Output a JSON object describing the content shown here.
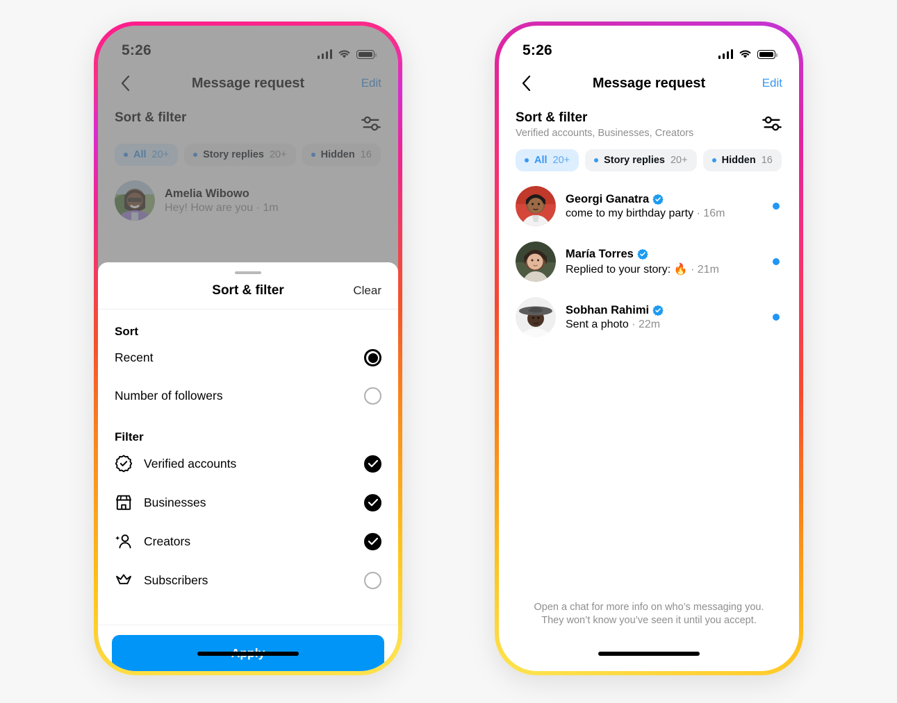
{
  "status_bar": {
    "time": "5:26",
    "signal_icon": "cellular-signal-icon",
    "wifi_icon": "wifi-icon",
    "battery_icon": "battery-full-icon"
  },
  "nav": {
    "back_icon": "chevron-left-icon",
    "title": "Message request",
    "edit_label": "Edit"
  },
  "colors": {
    "accent_blue": "#3797f0",
    "apply_blue": "#0095f6",
    "unread_blue": "#2196f3",
    "muted_gray": "#8e8e8e",
    "chip_bg": "#f1f2f4",
    "chip_active_bg": "#ddeeff"
  },
  "left_phone": {
    "sort_filter": {
      "title": "Sort & filter",
      "subtitle": "",
      "slider_icon": "sliders-icon"
    },
    "chips": [
      {
        "label": "All",
        "count": "20+",
        "active": true
      },
      {
        "label": "Story replies",
        "count": "20+",
        "active": false
      },
      {
        "label": "Hidden",
        "count": "16",
        "active": false
      }
    ],
    "messages": [
      {
        "name": "Amelia Wibowo",
        "preview": "Hey! How are you",
        "time": "· 1m",
        "verified": false,
        "unread": false
      }
    ],
    "sheet": {
      "grabber": "drag-handle",
      "title": "Sort & filter",
      "clear_label": "Clear",
      "sort_heading": "Sort",
      "sort_options": [
        {
          "label": "Recent",
          "selected": true
        },
        {
          "label": "Number of followers",
          "selected": false
        }
      ],
      "filter_heading": "Filter",
      "filter_options": [
        {
          "label": "Verified accounts",
          "icon": "verified-badge-icon",
          "checked": true
        },
        {
          "label": "Businesses",
          "icon": "storefront-icon",
          "checked": true
        },
        {
          "label": "Creators",
          "icon": "creator-person-star-icon",
          "checked": true
        },
        {
          "label": "Subscribers",
          "icon": "crown-icon",
          "checked": false
        }
      ],
      "apply_label": "Apply"
    }
  },
  "right_phone": {
    "sort_filter": {
      "title": "Sort & filter",
      "subtitle": "Verified accounts, Businesses, Creators",
      "slider_icon": "sliders-icon"
    },
    "chips": [
      {
        "label": "All",
        "count": "20+",
        "active": true
      },
      {
        "label": "Story replies",
        "count": "20+",
        "active": false
      },
      {
        "label": "Hidden",
        "count": "16",
        "active": false
      }
    ],
    "messages": [
      {
        "name": "Georgi Ganatra",
        "preview": "come to my birthday party",
        "time": "· 16m",
        "verified": true,
        "unread": true
      },
      {
        "name": "María Torres",
        "preview": "Replied to your story: 🔥",
        "time": "· 21m",
        "verified": true,
        "unread": true
      },
      {
        "name": "Sobhan Rahimi",
        "preview": "Sent a photo",
        "time": "· 22m",
        "verified": true,
        "unread": true
      }
    ],
    "footer_note": "Open a chat for more info on who’s messaging you. They won’t know you’ve seen it until you accept."
  }
}
